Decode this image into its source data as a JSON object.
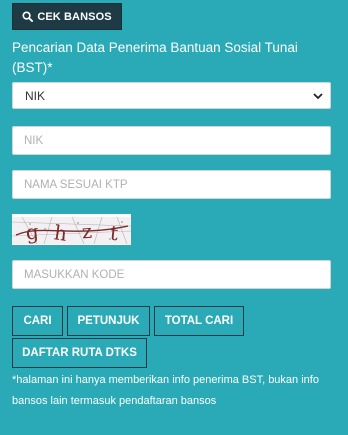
{
  "header": {
    "button_label": "CEK BANSOS",
    "icon": "search-icon"
  },
  "form": {
    "title": "Pencarian Data Penerima Bantuan Sosial Tunai (BST)*",
    "select": {
      "selected": "NIK",
      "icon": "chevron-down-icon"
    },
    "nik_input": {
      "placeholder": "NIK",
      "value": ""
    },
    "nama_input": {
      "placeholder": "NAMA SESUAI KTP",
      "value": ""
    },
    "captcha": {
      "text": "ghzt"
    },
    "kode_input": {
      "placeholder": "MASUKKAN KODE",
      "value": ""
    }
  },
  "buttons": {
    "cari": "CARI",
    "petunjuk": "PETUNJUK",
    "total_cari": "TOTAL CARI",
    "daftar_ruta": "DAFTAR RUTA DTKS"
  },
  "note": "*halaman ini hanya memberikan info penerima BST, bukan info bansos lain termasuk pendaftaran bansos",
  "colors": {
    "background": "#2aaab7",
    "header_button": "#1d3a45",
    "button_border": "#1d3a45",
    "text": "#ffffff"
  }
}
